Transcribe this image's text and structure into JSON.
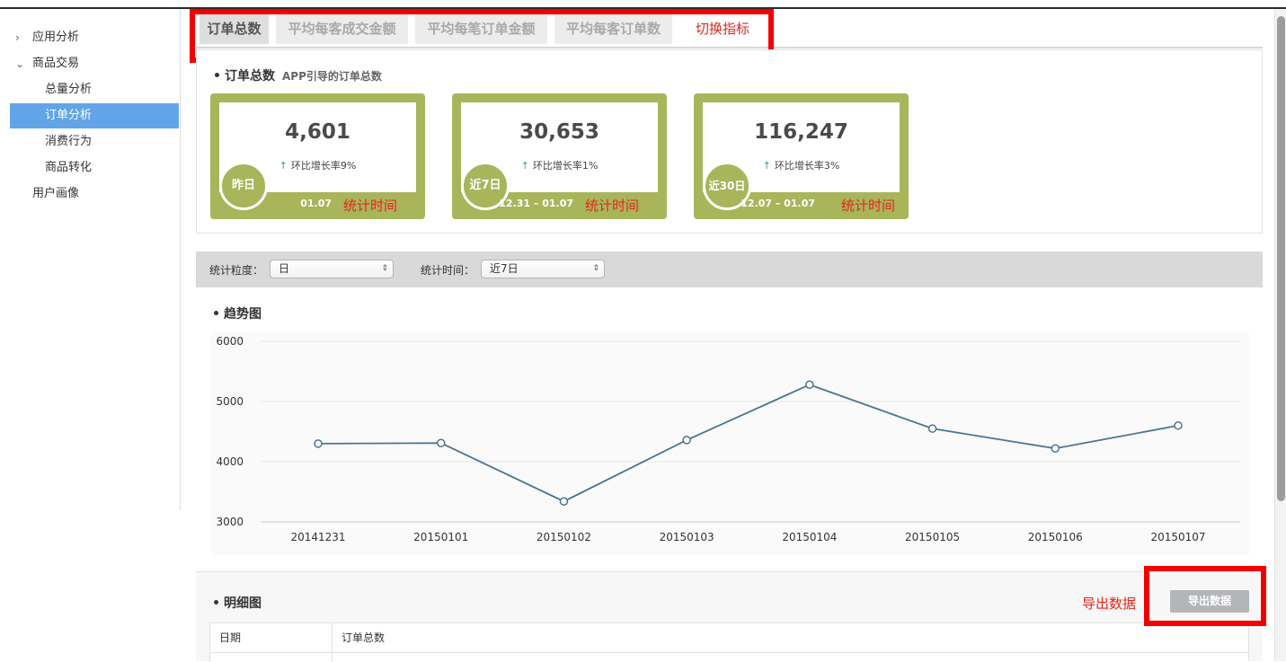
{
  "sidebar": {
    "items": [
      {
        "label": "应用分析",
        "chevron": "›",
        "level": 0
      },
      {
        "label": "商品交易",
        "chevron": "⌄",
        "level": 0
      },
      {
        "label": "总量分析",
        "level": 1
      },
      {
        "label": "订单分析",
        "level": 1,
        "active": true
      },
      {
        "label": "消费行为",
        "level": 1
      },
      {
        "label": "商品转化",
        "level": 1
      },
      {
        "label": "用户画像",
        "level": 0
      }
    ]
  },
  "tabs": [
    {
      "label": "订单总数",
      "active": true
    },
    {
      "label": "平均每客成交金额"
    },
    {
      "label": "平均每笔订单金额"
    },
    {
      "label": "平均每客订单数"
    }
  ],
  "tab_note": "切换指标",
  "summary": {
    "title": "订单总数",
    "subtitle": "APP引导的订单总数",
    "cards": [
      {
        "value": "4,601",
        "growth": "环比增长率9%",
        "badge": "昨日",
        "date": "01.07",
        "note": "统计时间"
      },
      {
        "value": "30,653",
        "growth": "环比增长率1%",
        "badge": "近7日",
        "date": "12.31 – 01.07",
        "note": "统计时间"
      },
      {
        "value": "116,247",
        "growth": "环比增长率3%",
        "badge": "近30日",
        "date": "12.07 – 01.07",
        "note": "统计时间"
      }
    ],
    "card_color": "#a8b55a",
    "growth_arrow": "↑"
  },
  "filters": {
    "granularity_label": "统计粒度：",
    "granularity_value": "日",
    "time_label": "统计时间：",
    "time_value": "近7日",
    "updown_icon": "⇕"
  },
  "trend": {
    "title": "趋势图"
  },
  "chart_data": {
    "type": "line",
    "categories": [
      "20141231",
      "20150101",
      "20150102",
      "20150103",
      "20150104",
      "20150105",
      "20150106",
      "20150107"
    ],
    "values": [
      4300,
      4310,
      3340,
      4360,
      5280,
      4550,
      4220,
      4600
    ],
    "ylim": [
      3000,
      6000
    ],
    "yticks": [
      3000,
      4000,
      5000,
      6000
    ],
    "grid": true,
    "line_color": "#4a7590"
  },
  "detail": {
    "title": "明细图",
    "export_note": "导出数据",
    "export_button": "导出数据",
    "columns": [
      "日期",
      "订单总数"
    ]
  }
}
